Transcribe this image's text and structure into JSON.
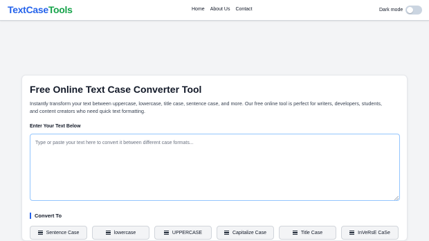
{
  "navbar": {
    "logo_part1": "Text",
    "logo_part2": "Case",
    "logo_part3": "Tools",
    "links": [
      "Home",
      "About Us",
      "Contact"
    ],
    "dark_mode_label": "Dark mode",
    "dark_mode_on": false
  },
  "main": {
    "title": "Free Online Text Case Converter Tool",
    "description": "Instantly transform your text between uppercase, lowercase, title case, sentence case, and more. Our free online tool is perfect for writers, developers, students, and content creators who need quick text formatting.",
    "input_label": "Enter Your Text Below",
    "input_value": "",
    "input_placeholder": "Type or paste your text here to convert it between different case formats...",
    "convert_label": "Convert To",
    "buttons": [
      "Sentence Case",
      "lowercase",
      "UPPERCASE",
      "Capitalize Case",
      "Title Case",
      "InVeRsE CaSe"
    ]
  },
  "colors": {
    "brand_blue": "#2563eb",
    "brand_green": "#16a34a",
    "focus_border": "#93c5fd"
  }
}
